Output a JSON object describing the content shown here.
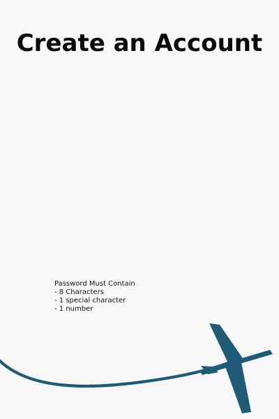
{
  "page": {
    "title": "Create an Account"
  },
  "password_requirements": {
    "heading": "Password Must Contain",
    "items": [
      "- 8 Characters",
      "- 1 special character",
      "- 1 number"
    ]
  },
  "decoration": {
    "icon": "airplane-icon",
    "color": "#1f5b77"
  }
}
